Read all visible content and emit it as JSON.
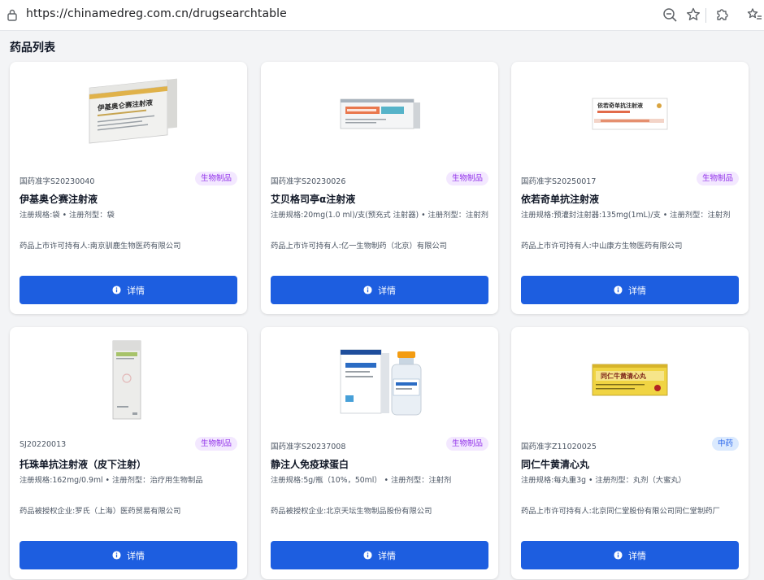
{
  "browser": {
    "url": "https://chinamedreg.com.cn/drugsearchtable"
  },
  "page": {
    "title": "药品列表"
  },
  "cards": [
    {
      "reg_no": "国药准字S20230040",
      "badge": "生物制品",
      "name": "伊基奥仑赛注射液",
      "spec": "注册规格:袋 • 注册剂型：袋",
      "holder": "药品上市许可持有人:南京驯鹿生物医药有限公司",
      "button": "详情"
    },
    {
      "reg_no": "国药准字S20230026",
      "badge": "生物制品",
      "name": "艾贝格司亭α注射液",
      "spec": "注册规格:20mg(1.0 ml)/支(预充式 注射器) • 注册剂型：注射剂",
      "holder": "药品上市许可持有人:亿一生物制药（北京）有限公司",
      "button": "详情"
    },
    {
      "reg_no": "国药准字S20250017",
      "badge": "生物制品",
      "name": "依若奇单抗注射液",
      "spec": "注册规格:预灌封注射器:135mg(1mL)/支 • 注册剂型：注射剂",
      "holder": "药品上市许可持有人:中山康方生物医药有限公司",
      "button": "详情"
    },
    {
      "reg_no": "SJ20220013",
      "badge": "生物制品",
      "name": "托珠单抗注射液（皮下注射）",
      "spec": "注册规格:162mg/0.9ml • 注册剂型：治疗用生物制品",
      "holder": "药品被授权企业:罗氏（上海）医药贸易有限公司",
      "button": "详情"
    },
    {
      "reg_no": "国药准字S20237008",
      "badge": "生物制品",
      "name": "静注人免疫球蛋白",
      "spec": "注册规格:5g/瓶（10%，50ml） • 注册剂型：注射剂",
      "holder": "药品被授权企业:北京天坛生物制品股份有限公司",
      "button": "详情"
    },
    {
      "reg_no": "国药准字Z11020025",
      "badge": "中药",
      "name": "同仁牛黄清心丸",
      "spec": "注册规格:每丸重3g • 注册剂型：丸剂（大蜜丸）",
      "holder": "药品上市许可持有人:北京同仁堂股份有限公司同仁堂制药厂",
      "button": "详情"
    }
  ],
  "product_labels": {
    "card1_box": "伊基奥仑赛注射液",
    "card3_box": "依若奇单抗注射液",
    "card6_box": "同仁牛黄清心丸"
  },
  "colors": {
    "primary_button": "#1d5ee0",
    "badge_bio_bg": "#f3e8ff",
    "badge_bio_text": "#9333ea",
    "badge_tcm_bg": "#dbeafe",
    "badge_tcm_text": "#2563eb",
    "page_bg": "#f3f4f6"
  }
}
